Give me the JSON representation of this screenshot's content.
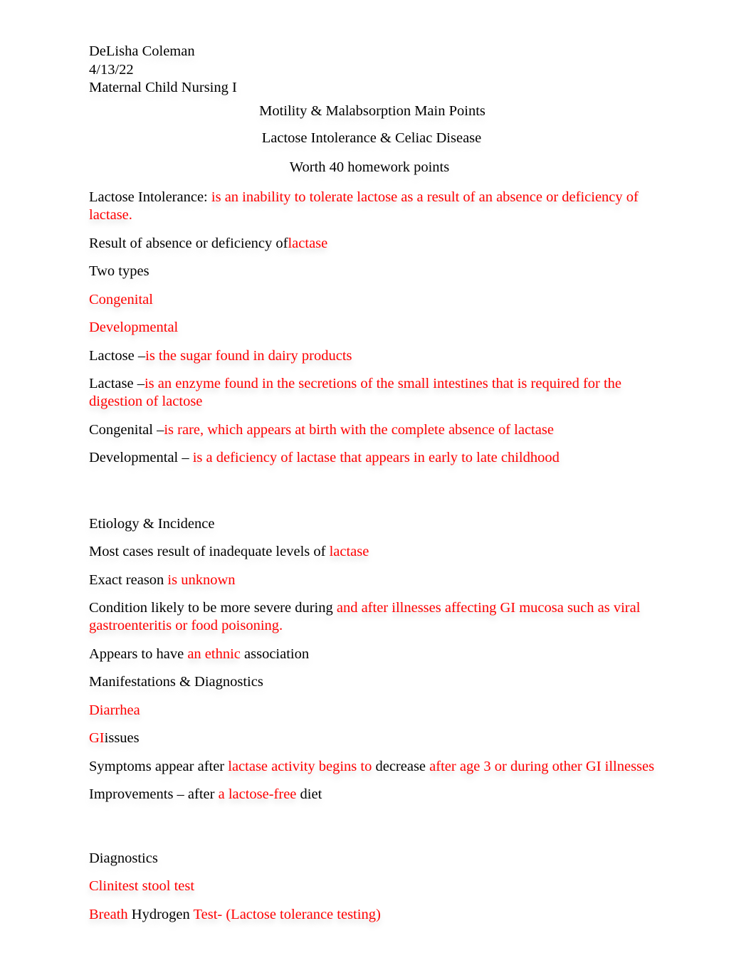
{
  "document": {
    "header": {
      "student_name": "DeLisha Coleman",
      "date": "4/13/22",
      "course": "Maternal Child Nursing I"
    },
    "titles": {
      "line1": "Motility & Malabsorption Main Points",
      "line2": "Lactose Intolerance & Celiac Disease",
      "line3": "Worth 40 homework points"
    },
    "colors": {
      "prompt_text": "#000000",
      "answer_text": "#ff0000",
      "page_background": "#ffffff"
    },
    "body": {
      "p1": {
        "prompt": "Lactose Intolerance: ",
        "answer": "is an inability to tolerate lactose as a result of an absence or deficiency of lactase."
      },
      "p2": {
        "prompt": "Result of absence or deficiency of",
        "answer": "lactase"
      },
      "p3": {
        "prompt": "Two types"
      },
      "p4": {
        "answer": "Congenital"
      },
      "p5": {
        "answer": "Developmental"
      },
      "p6": {
        "prompt": "Lactose –",
        "answer": "is the sugar found in dairy products"
      },
      "p7": {
        "prompt": "Lactase –",
        "answer": "is an enzyme found in the secretions of the small intestines that is required for the digestion of lactose"
      },
      "p8": {
        "prompt": "Congenital –",
        "answer": "is rare, which appears at birth with the complete absence of lactase"
      },
      "p9": {
        "prompt": "Developmental – ",
        "answer": "is a deficiency of lactase that appears in early to late childhood"
      },
      "p10": {
        "prompt": "Etiology & Incidence"
      },
      "p11": {
        "prompt": "Most cases result of inadequate levels of  ",
        "answer": "lactase"
      },
      "p12": {
        "prompt": "Exact reason ",
        "answer": "is unknown"
      },
      "p13": {
        "prompt": "Condition likely to be more severe during ",
        "answer": "and after illnesses affecting GI mucosa such as viral gastroenteritis or food poisoning."
      },
      "p14": {
        "prompt_before": "Appears to have ",
        "answer": "an ethnic",
        "prompt_after": " association"
      },
      "p15": {
        "prompt": "Manifestations & Diagnostics"
      },
      "p16": {
        "answer": "Diarrhea"
      },
      "p17": {
        "answer": "GI",
        "prompt_after": "issues"
      },
      "p18": {
        "prompt_before": "Symptoms appear after ",
        "answer1": "lactase activity begins to",
        "prompt_mid": " decrease ",
        "answer2": " after age 3 or during other GI illnesses"
      },
      "p19": {
        "prompt_before": "Improvements – after ",
        "answer": "a lactose-free",
        "prompt_after": " diet"
      },
      "p20": {
        "prompt": "Diagnostics"
      },
      "p21": {
        "answer": "Clinitest stool test"
      },
      "p22": {
        "answer1": "Breath",
        "prompt_mid": " Hydrogen ",
        "answer2": "Test- (Lactose tolerance testing)"
      }
    }
  }
}
